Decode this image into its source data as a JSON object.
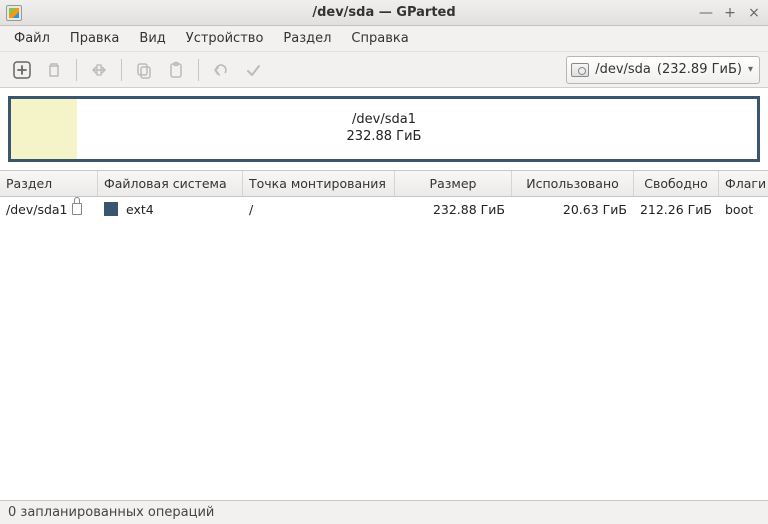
{
  "window": {
    "title": "/dev/sda — GParted"
  },
  "menu": {
    "file": "Файл",
    "edit": "Правка",
    "view": "Вид",
    "device": "Устройство",
    "partition": "Раздел",
    "help": "Справка"
  },
  "device_selector": {
    "device": "/dev/sda",
    "size": "(232.89 ГиБ)"
  },
  "partition_graphic": {
    "name": "/dev/sda1",
    "size": "232.88 ГиБ",
    "used_fraction": 0.089
  },
  "columns": {
    "partition": "Раздел",
    "filesystem": "Файловая система",
    "mountpoint": "Точка монтирования",
    "size": "Размер",
    "used": "Использовано",
    "free": "Свободно",
    "flags": "Флаги"
  },
  "rows": [
    {
      "partition": "/dev/sda1",
      "locked": true,
      "fs_color": "#3a556e",
      "filesystem": "ext4",
      "mountpoint": "/",
      "size": "232.88 ГиБ",
      "used": "20.63 ГиБ",
      "free": "212.26 ГиБ",
      "flags": "boot"
    }
  ],
  "statusbar": {
    "pending": "0 запланированных операций"
  }
}
